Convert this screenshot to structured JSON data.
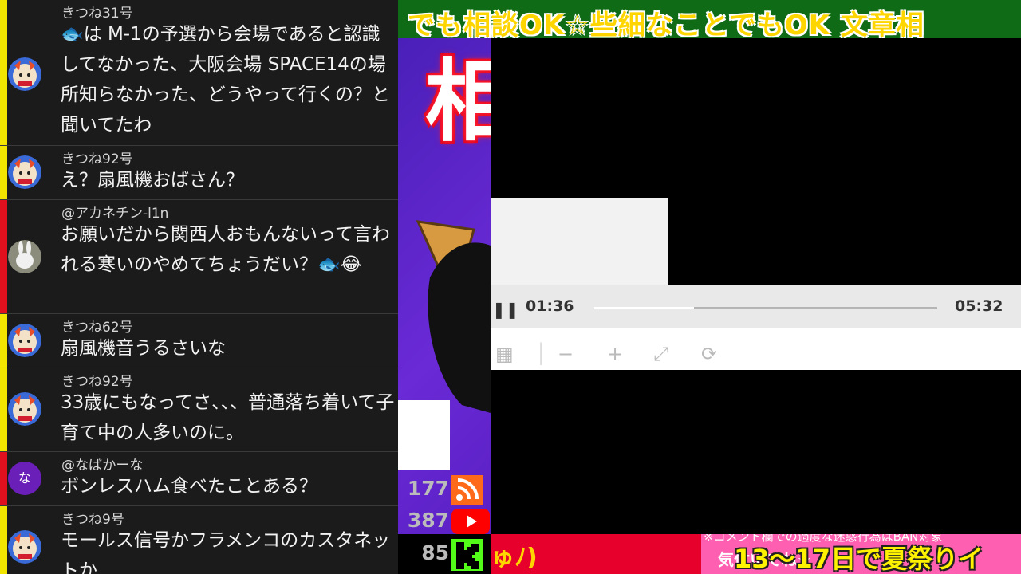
{
  "chat": {
    "messages": [
      {
        "author": "きつね31号",
        "text": "🐟は M-1の予選から会場であると認識してなかった、大阪会場 SPACE14の場所知らなかった、どうやって行くの？と聞いてたわ",
        "bar": "#f2e600",
        "avatar": "fox-avatar"
      },
      {
        "author": "きつね92号",
        "text": "え？扇風機おばさん？",
        "bar": "#f2e600",
        "avatar": "fox-avatar"
      },
      {
        "author": "@アカネチン-l1n",
        "text": "お願いだから関西人おもんないって言われる寒いのやめてちょうだい？🐟😂",
        "bar": "#e0101e",
        "avatar": "rabbit-avatar"
      },
      {
        "author": "きつね62号",
        "text": "扇風機音うるさいな",
        "bar": "#f2e600",
        "avatar": "fox-avatar"
      },
      {
        "author": "きつね92号",
        "text": "33歳にもなってさ、、、普通落ち着いて子育て中の人多いのに。",
        "bar": "#f2e600",
        "avatar": "fox-avatar"
      },
      {
        "author": "@なばかーな",
        "text": "ボンレスハム食べたことある？",
        "bar": "#e0101e",
        "avatar": "letter-avatar",
        "avatar_letter": "な"
      },
      {
        "author": "きつね9号",
        "text": "モールス信号かフラメンコのカスタネットか",
        "bar": "#f2e600",
        "avatar": "fox-avatar"
      }
    ]
  },
  "ticker": {
    "text": "でも相談OK☆些細なことでもOK 文章相"
  },
  "stage": {
    "big_kanji": "相"
  },
  "player": {
    "current_time": "01:36",
    "duration": "05:32",
    "progress": 0.29,
    "pause_icon": "❚❚",
    "toolbar_icons": [
      "grid-icon",
      "minus-icon",
      "plus-icon",
      "expand-icon",
      "refresh-icon"
    ]
  },
  "counts": [
    "177",
    "387",
    "85"
  ],
  "bottom": {
    "left_text": "ゅﾉ)",
    "notice": "※コメント欄での過度な迷惑行為はBAN対象",
    "sub": "気付いてね☆",
    "main": "13〜17日で夏祭りイ"
  },
  "colors": {
    "youtube": "#ff0000",
    "kick": "#53fc18",
    "rss": "#ff6a1a"
  }
}
